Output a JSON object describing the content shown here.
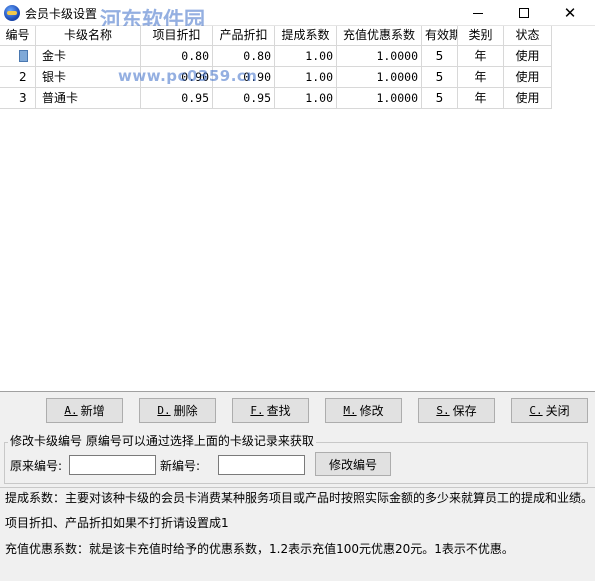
{
  "window": {
    "title": "会员卡级设置",
    "watermark_text": "河东软件园",
    "watermark_url": "www.pc0359.cn"
  },
  "table": {
    "columns": [
      "编号",
      "卡级名称",
      "项目折扣",
      "产品折扣",
      "提成系数",
      "充值优惠系数",
      "有效期",
      "类别",
      "状态"
    ],
    "rows": [
      {
        "id": "1",
        "name": "金卡",
        "item_discount": "0.80",
        "product_discount": "0.80",
        "commission": "1.00",
        "recharge_factor": "1.0000",
        "validity": "5",
        "type": "年",
        "status": "使用"
      },
      {
        "id": "2",
        "name": "银卡",
        "item_discount": "0.90",
        "product_discount": "0.90",
        "commission": "1.00",
        "recharge_factor": "1.0000",
        "validity": "5",
        "type": "年",
        "status": "使用"
      },
      {
        "id": "3",
        "name": "普通卡",
        "item_discount": "0.95",
        "product_discount": "0.95",
        "commission": "1.00",
        "recharge_factor": "1.0000",
        "validity": "5",
        "type": "年",
        "status": "使用"
      }
    ]
  },
  "buttons": {
    "add": {
      "key": "A.",
      "label": "新增"
    },
    "delete": {
      "key": "D.",
      "label": "删除"
    },
    "find": {
      "key": "F.",
      "label": "查找"
    },
    "modify": {
      "key": "M.",
      "label": "修改"
    },
    "save": {
      "key": "S.",
      "label": "保存"
    },
    "close": {
      "key": "C.",
      "label": "关闭"
    }
  },
  "rename_group": {
    "legend": "修改卡级编号 原编号可以通过选择上面的卡级记录来获取",
    "old_label": "原来编号:",
    "old_value": "",
    "new_label": "新编号:",
    "new_value": "",
    "button_label": "修改编号"
  },
  "notes": [
    "提成系数：主要对该种卡级的会员卡消费某种服务项目或产品时按照实际金额的多少来就算员工的提成和业绩。",
    "项目折扣、产品折扣如果不打折请设置成1",
    "充值优惠系数：就是该卡充值时给予的优惠系数，1.2表示充值100元优惠20元。1表示不优惠。"
  ]
}
